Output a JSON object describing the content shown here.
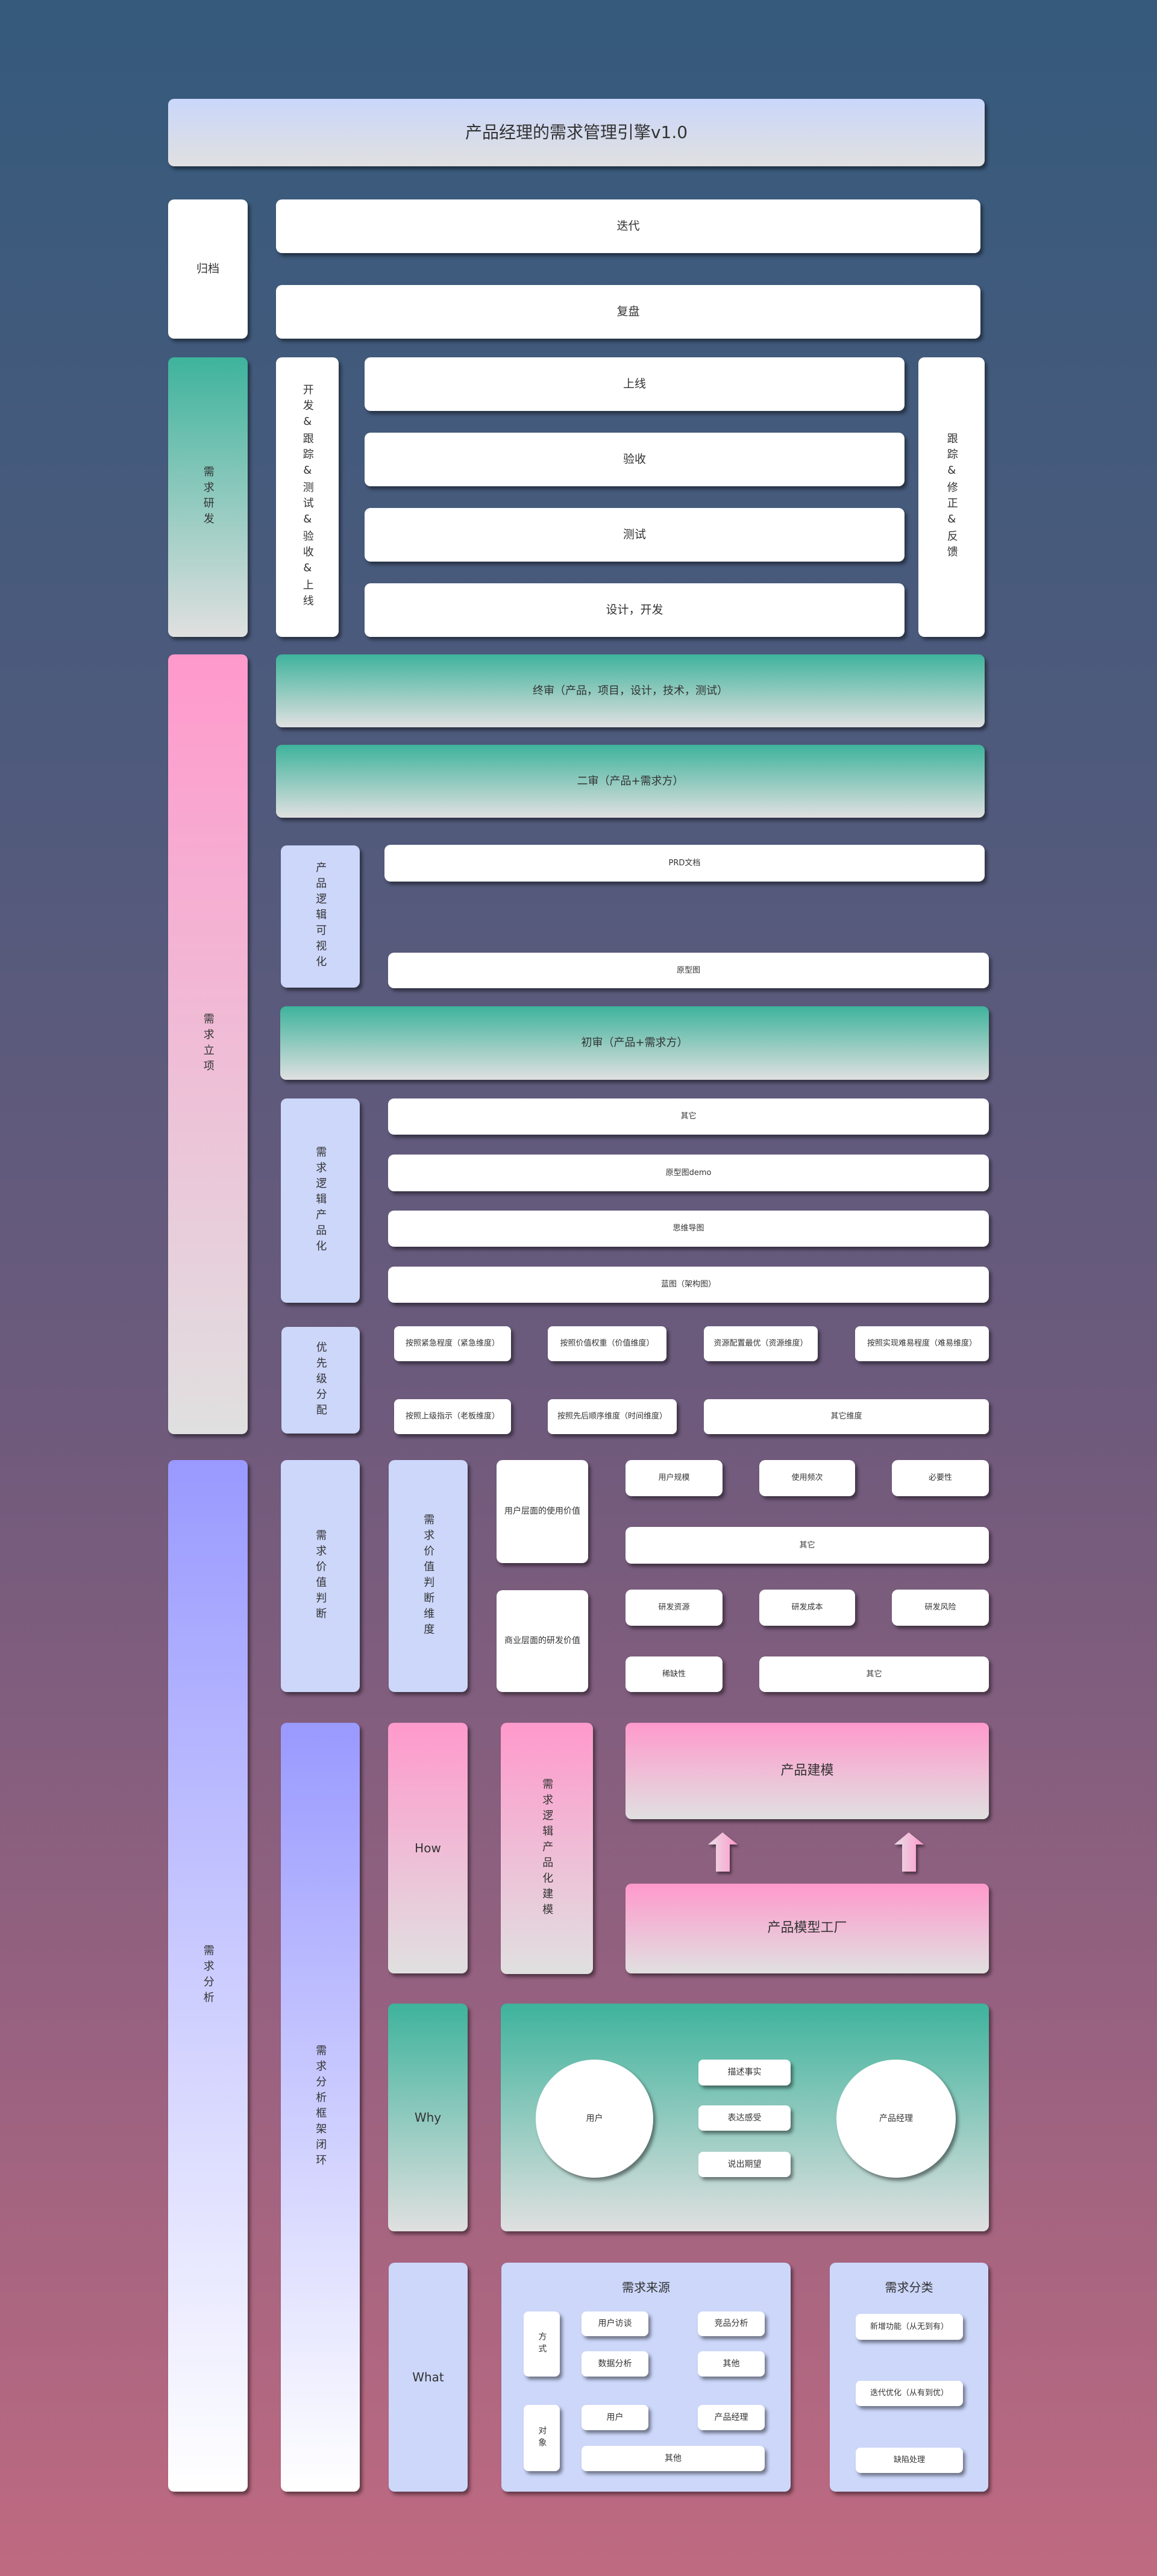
{
  "title": "产品经理的需求管理引擎v1.0",
  "archive": {
    "label": "归档",
    "items": [
      "迭代",
      "复盘"
    ]
  },
  "rnd": {
    "label": "需求研发",
    "process_label": "开发&跟踪&测试&验收&上线",
    "steps": [
      "上线",
      "验收",
      "测试",
      "设计，开发"
    ],
    "feedback_label": "跟踪&修正&反馈"
  },
  "initiation": {
    "label": "需求立项",
    "final_review": "终审（产品，项目，设计，技术，测试）",
    "second_review": "二审（产品+需求方）",
    "first_review": "初审（产品+需求方）",
    "visualization": {
      "label": "产品逻辑可视化",
      "items": [
        "PRD文档",
        "原型图"
      ]
    },
    "productization": {
      "label": "需求逻辑产品化",
      "items": [
        "其它",
        "原型图demo",
        "思维导图",
        "蓝图（架构图）"
      ]
    },
    "priority": {
      "label": "优先级分配",
      "items": [
        "按照紧急程度（紧急维度）",
        "按照价值权重（价值维度）",
        "资源配置最优（资源维度）",
        "按照实现难易程度（难易维度）",
        "按照上级指示（老板维度）",
        "按照先后顺序维度（时间维度）",
        "其它维度"
      ]
    }
  },
  "analysis": {
    "label": "需求分析",
    "value_judgment": {
      "label": "需求价值判断",
      "dimension_label": "需求价值判断维度",
      "user_value": {
        "label": "用户层面的使用价值",
        "items": [
          "用户规模",
          "使用频次",
          "必要性",
          "其它"
        ]
      },
      "business_value": {
        "label": "商业层面的研发价值",
        "items": [
          "研发资源",
          "研发成本",
          "研发风险",
          "稀缺性",
          "其它"
        ]
      }
    },
    "framework": {
      "label": "需求分析框架闭环",
      "how": {
        "label": "How",
        "modeling_label": "需求逻辑产品化建模",
        "product_modeling": "产品建模",
        "model_factory": "产品模型工厂"
      },
      "why": {
        "label": "Why",
        "user": "用户",
        "pm": "产品经理",
        "actions": [
          "描述事实",
          "表达感受",
          "说出期望"
        ]
      },
      "what": {
        "label": "What",
        "sources": {
          "title": "需求来源",
          "method_label": "方式",
          "methods": [
            "用户访谈",
            "竞品分析",
            "数据分析",
            "其他"
          ],
          "object_label": "对象",
          "objects": [
            "用户",
            "产品经理",
            "其他"
          ]
        },
        "categories": {
          "title": "需求分类",
          "items": [
            "新增功能（从无到有）",
            "迭代优化（从有到优）",
            "缺陷处理"
          ]
        }
      }
    }
  },
  "palette": {
    "bg_top": "#355a7c",
    "bg_bottom": "#bf6a81",
    "teal": "#3eb39c",
    "pink": "#ff99cc",
    "periwinkle": "#9999ff",
    "lavender": "#ccd7fa",
    "title_blue": "#cad7fb",
    "text": "#333333"
  }
}
